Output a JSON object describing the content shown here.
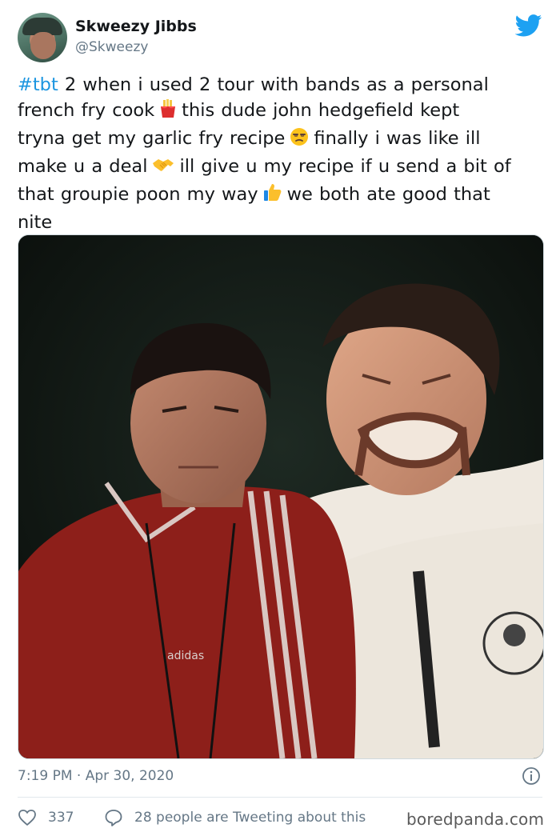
{
  "user": {
    "display_name": "Skweezy Jibbs",
    "handle": "@Skweezy"
  },
  "tweet": {
    "lines": [
      {
        "hashtag": "#tbt",
        "text": " 2 when i used 2 tour with bands as a personal"
      },
      {
        "before": "french fry cook",
        "emoji": "fries-emoji",
        "after": "this dude john hedgefield kept"
      },
      {
        "before": "tryna get my garlic fry recipe",
        "emoji": "unamused-face-emoji",
        "after": "finally i was like ill"
      },
      {
        "before": "make u a deal",
        "emoji": "handshake-emoji",
        "after": "ill give u my recipe if u send a bit of"
      },
      {
        "before": "that groupie poon my way",
        "emoji": "thumbs-up-emoji",
        "after": "we both ate good that"
      },
      {
        "text": "nite"
      }
    ]
  },
  "photo": {
    "shirt_logo_text": "adidas"
  },
  "footer": {
    "timestamp": "7:19 PM · Apr 30, 2020",
    "likes": "337",
    "tweeting": "28 people are Tweeting about this"
  },
  "watermark": "boredpanda.com",
  "icons": {
    "brand": "twitter-bird-icon",
    "info": "info-icon",
    "like": "heart-icon",
    "reply": "speech-bubble-icon"
  },
  "colors": {
    "link": "#1b95e0",
    "text": "#14171a",
    "muted": "#657786",
    "divider": "#e1e8ed"
  }
}
